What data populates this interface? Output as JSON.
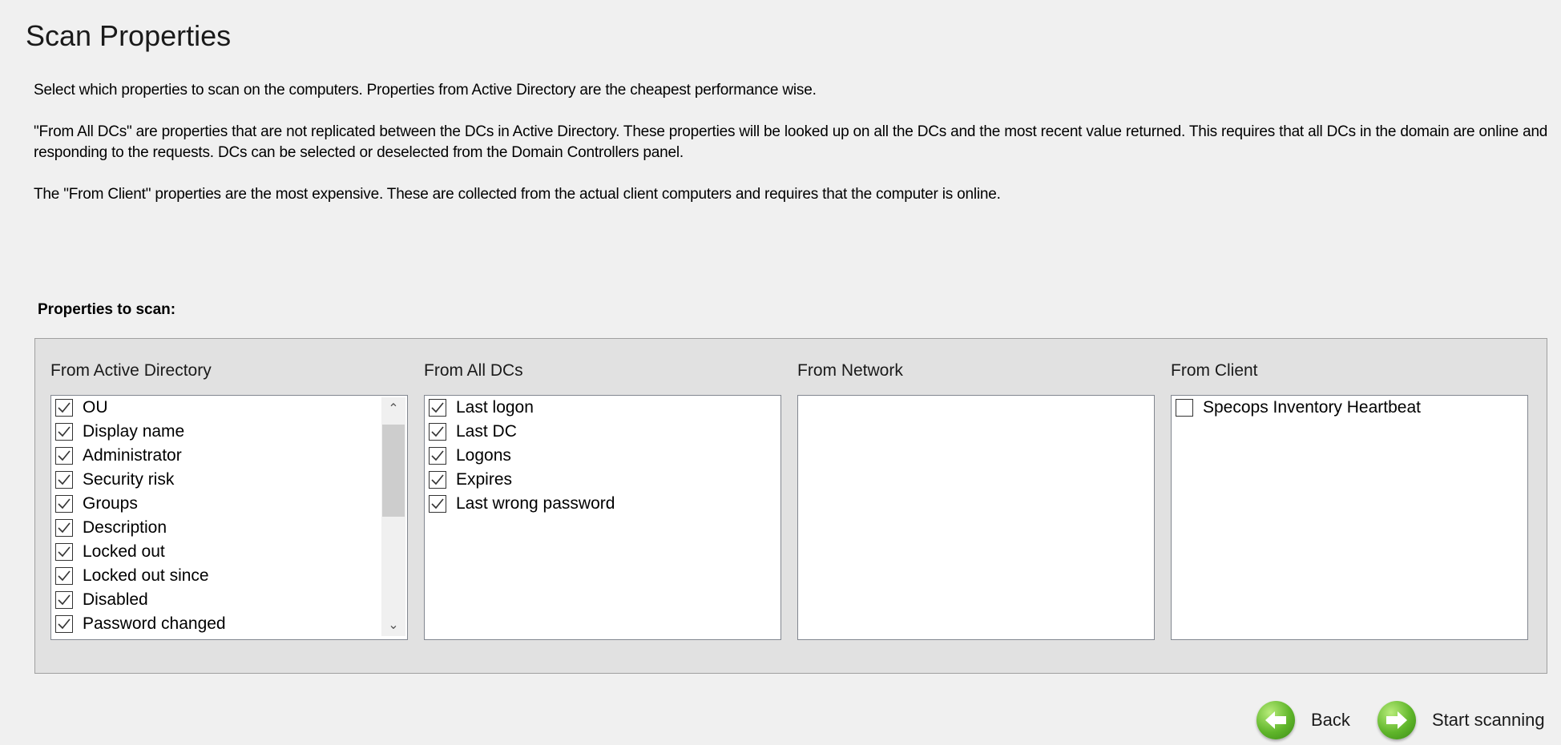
{
  "title": "Scan Properties",
  "paragraphs": [
    "Select which properties to scan on the computers. Properties from Active Directory are the cheapest performance wise.",
    "\"From All DCs\" are properties that are not replicated between the DCs in Active Directory. These properties will be looked up on all the DCs and the most recent value returned. This requires that all DCs in the domain are online and responding to the requests. DCs can be selected or deselected from the Domain Controllers panel.",
    "The \"From Client\" properties are the most expensive. These are collected from the actual client computers and requires that the computer is online."
  ],
  "properties_label": "Properties to scan:",
  "columns": [
    {
      "label": "From Active Directory",
      "items": [
        {
          "label": "OU",
          "checked": true
        },
        {
          "label": "Display name",
          "checked": true
        },
        {
          "label": "Administrator",
          "checked": true
        },
        {
          "label": "Security risk",
          "checked": true
        },
        {
          "label": "Groups",
          "checked": true
        },
        {
          "label": "Description",
          "checked": true
        },
        {
          "label": "Locked out",
          "checked": true
        },
        {
          "label": "Locked out since",
          "checked": true
        },
        {
          "label": "Disabled",
          "checked": true
        },
        {
          "label": "Password changed",
          "checked": true
        }
      ],
      "scrollbar": true
    },
    {
      "label": "From All DCs",
      "items": [
        {
          "label": "Last logon",
          "checked": true
        },
        {
          "label": "Last DC",
          "checked": true
        },
        {
          "label": "Logons",
          "checked": true
        },
        {
          "label": "Expires",
          "checked": true
        },
        {
          "label": "Last wrong password",
          "checked": true
        }
      ]
    },
    {
      "label": "From Network",
      "items": []
    },
    {
      "label": "From Client",
      "items": [
        {
          "label": "Specops Inventory Heartbeat",
          "checked": false
        }
      ]
    }
  ],
  "buttons": {
    "back": "Back",
    "start": "Start scanning"
  },
  "colors": {
    "accent_green": "#5fb52a"
  }
}
